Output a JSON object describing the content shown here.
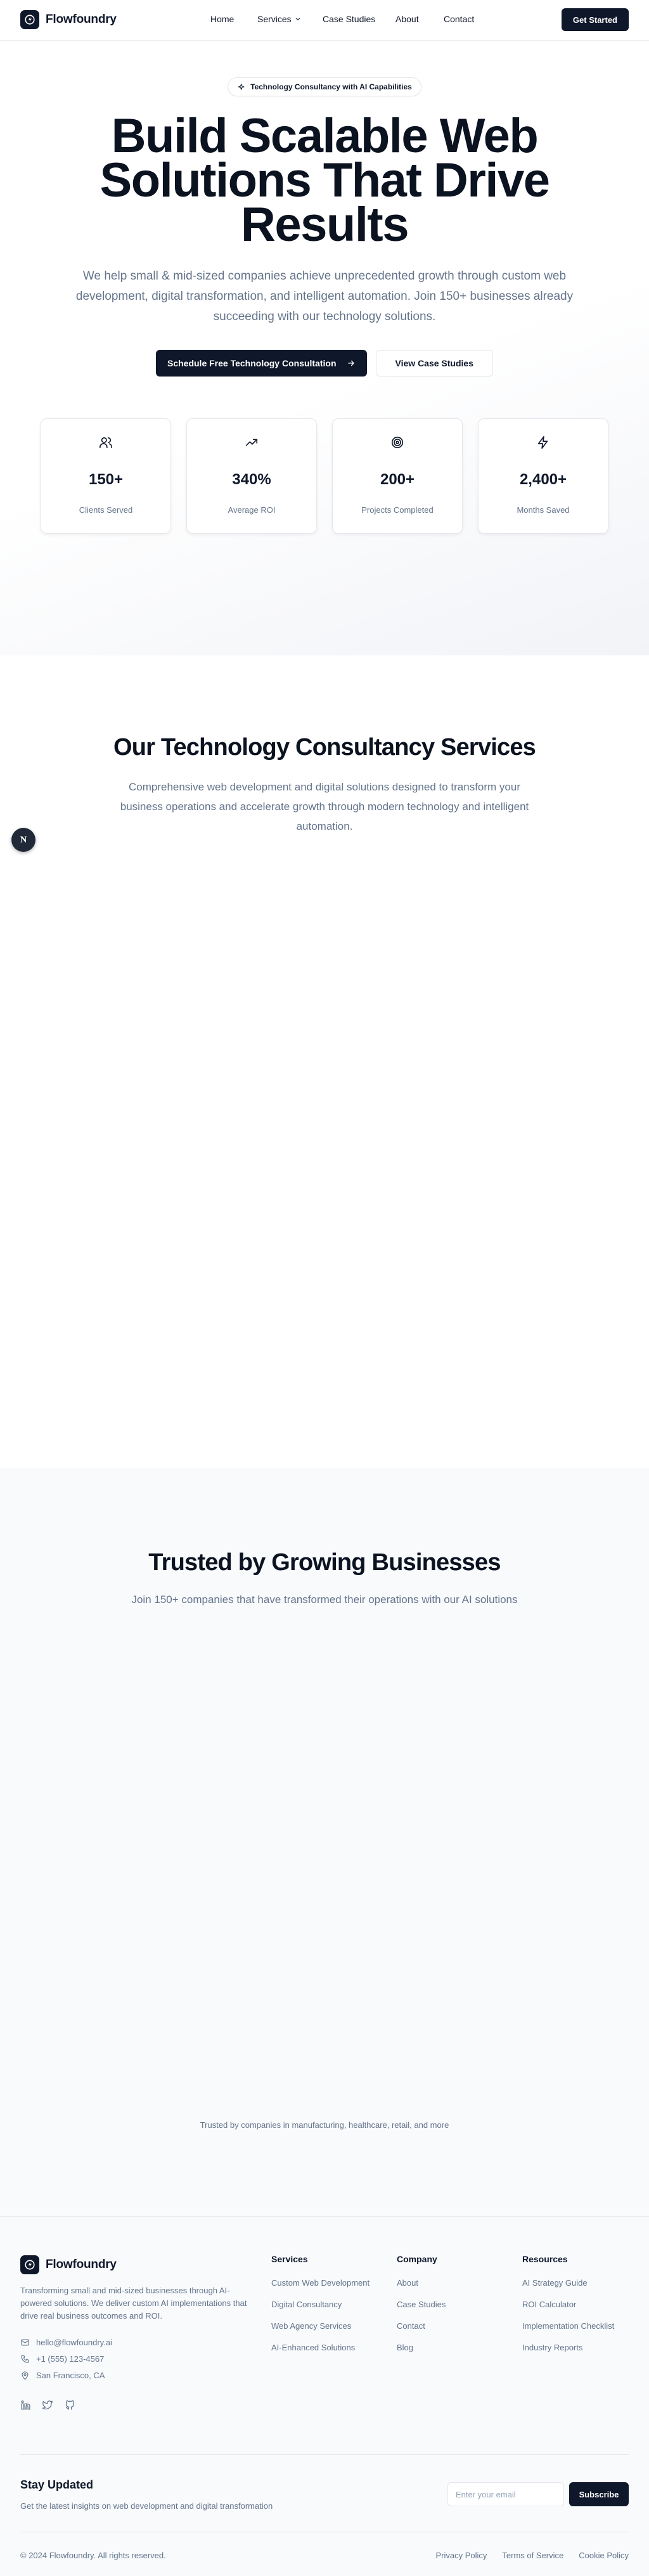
{
  "brand": {
    "name": "Flowfoundry"
  },
  "nav": {
    "items": [
      "Home",
      "Services",
      "Case Studies",
      "About",
      "Contact"
    ],
    "cta": "Get Started"
  },
  "hero": {
    "badge": "Technology Consultancy with AI Capabilities",
    "title": "Build Scalable Web Solutions That Drive Results",
    "subtitle": "We help small & mid-sized companies achieve unprecedented growth through custom web development, digital transformation, and intelligent automation. Join 150+ businesses already succeeding with our technology solutions.",
    "primary_cta": "Schedule Free Technology Consultation",
    "secondary_cta": "View Case Studies",
    "stats": [
      {
        "icon": "users-icon",
        "value": "150+",
        "label": "Clients Served"
      },
      {
        "icon": "trending-up-icon",
        "value": "340%",
        "label": "Average ROI"
      },
      {
        "icon": "target-icon",
        "value": "200+",
        "label": "Projects Completed"
      },
      {
        "icon": "zap-icon",
        "value": "2,400+",
        "label": "Months Saved"
      }
    ]
  },
  "services": {
    "title": "Our Technology Consultancy Services",
    "subtitle": "Comprehensive web development and digital solutions designed to transform your business operations and accelerate growth through modern technology and intelligent automation."
  },
  "fab": {
    "label": "N"
  },
  "trusted": {
    "title": "Trusted by Growing Businesses",
    "subtitle": "Join 150+ companies that have transformed their operations with our AI solutions",
    "note": "Trusted by companies in manufacturing, healthcare, retail, and more"
  },
  "footer": {
    "description": "Transforming small and mid-sized businesses through AI-powered solutions. We deliver custom AI implementations that drive real business outcomes and ROI.",
    "email": "hello@flowfoundry.ai",
    "phone": "+1 (555) 123-4567",
    "location": "San Francisco, CA",
    "columns": [
      {
        "title": "Services",
        "links": [
          "Custom Web Development",
          "Digital Consultancy",
          "Web Agency Services",
          "AI-Enhanced Solutions"
        ]
      },
      {
        "title": "Company",
        "links": [
          "About",
          "Case Studies",
          "Contact",
          "Blog"
        ]
      },
      {
        "title": "Resources",
        "links": [
          "AI Strategy Guide",
          "ROI Calculator",
          "Implementation Checklist",
          "Industry Reports"
        ]
      }
    ],
    "newsletter": {
      "title": "Stay Updated",
      "subtitle": "Get the latest insights on web development and digital transformation",
      "placeholder": "Enter your email",
      "button": "Subscribe"
    },
    "copyright": "© 2024 Flowfoundry. All rights reserved.",
    "legal": [
      "Privacy Policy",
      "Terms of Service",
      "Cookie Policy"
    ]
  }
}
